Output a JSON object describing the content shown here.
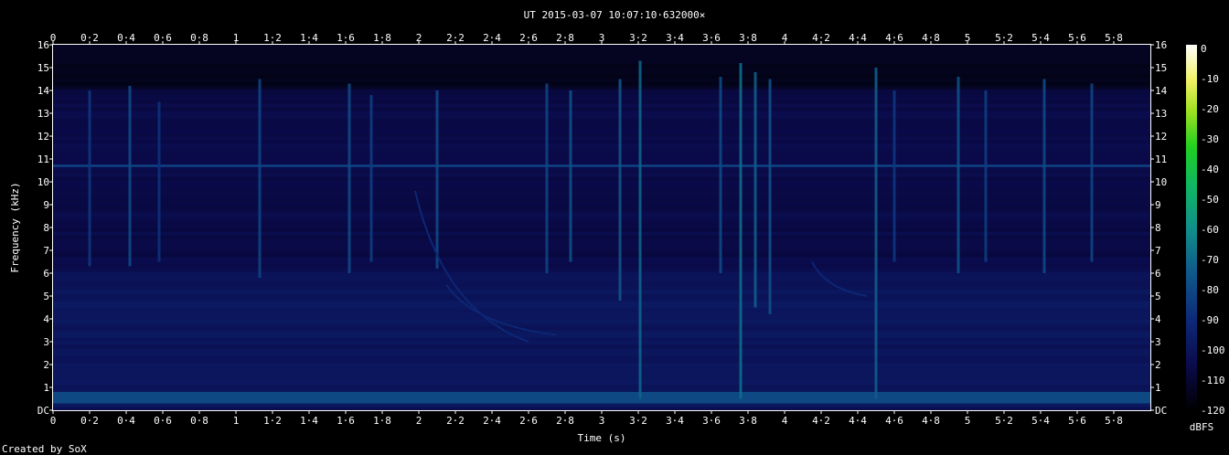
{
  "chart_data": {
    "type": "heatmap",
    "title": "UT 2015-03-07 10:07:10·632000×",
    "xlabel": "Time (s)",
    "ylabel": "Frequency (kHz)",
    "xlim": [
      0,
      5.98
    ],
    "ylim": [
      0,
      16
    ],
    "x_ticks": [
      "0",
      "0·2",
      "0·4",
      "0·6",
      "0·8",
      "1",
      "1·2",
      "1·4",
      "1·6",
      "1·8",
      "2",
      "2·2",
      "2·4",
      "2·6",
      "2·8",
      "3",
      "3·2",
      "3·4",
      "3·6",
      "3·8",
      "4",
      "4·2",
      "4·4",
      "4·6",
      "4·8",
      "5",
      "5·2",
      "5·4",
      "5·6",
      "5·8"
    ],
    "y_ticks": [
      "DC",
      "1",
      "2",
      "3",
      "4",
      "5",
      "6",
      "7",
      "8",
      "9",
      "10",
      "11",
      "12",
      "13",
      "14",
      "15",
      "16"
    ],
    "colorbar": {
      "label": "dBFS",
      "ticks": [
        "0",
        "-10",
        "-20",
        "-30",
        "-40",
        "-50",
        "-60",
        "-70",
        "-80",
        "-90",
        "-100",
        "-110",
        "-120"
      ],
      "range": [
        -120,
        0
      ]
    },
    "features": {
      "constant_tone_khz": 10.7,
      "low_band_khz": [
        0.3,
        0.8
      ],
      "impulses": [
        {
          "t": 0.2,
          "top": 14.0,
          "bottom": 6.3,
          "level": -86
        },
        {
          "t": 0.42,
          "top": 14.2,
          "bottom": 6.3,
          "level": -80
        },
        {
          "t": 0.58,
          "top": 13.5,
          "bottom": 6.5,
          "level": -88
        },
        {
          "t": 1.13,
          "top": 14.5,
          "bottom": 5.8,
          "level": -82
        },
        {
          "t": 1.62,
          "top": 14.3,
          "bottom": 6.0,
          "level": -80
        },
        {
          "t": 1.74,
          "top": 13.8,
          "bottom": 6.5,
          "level": -84
        },
        {
          "t": 2.1,
          "top": 14.0,
          "bottom": 6.2,
          "level": -80
        },
        {
          "t": 2.7,
          "top": 14.3,
          "bottom": 6.0,
          "level": -82
        },
        {
          "t": 2.83,
          "top": 14.0,
          "bottom": 6.5,
          "level": -78
        },
        {
          "t": 3.1,
          "top": 14.5,
          "bottom": 4.8,
          "level": -76
        },
        {
          "t": 3.21,
          "top": 15.3,
          "bottom": 0.5,
          "level": -72
        },
        {
          "t": 3.65,
          "top": 14.6,
          "bottom": 6.0,
          "level": -80
        },
        {
          "t": 3.76,
          "top": 15.2,
          "bottom": 0.5,
          "level": -70
        },
        {
          "t": 3.84,
          "top": 14.8,
          "bottom": 4.5,
          "level": -74
        },
        {
          "t": 3.92,
          "top": 14.5,
          "bottom": 4.2,
          "level": -78
        },
        {
          "t": 4.5,
          "top": 15.0,
          "bottom": 0.5,
          "level": -74
        },
        {
          "t": 4.6,
          "top": 14.0,
          "bottom": 6.5,
          "level": -86
        },
        {
          "t": 4.95,
          "top": 14.6,
          "bottom": 6.0,
          "level": -78
        },
        {
          "t": 5.1,
          "top": 14.0,
          "bottom": 6.5,
          "level": -84
        },
        {
          "t": 5.42,
          "top": 14.5,
          "bottom": 6.0,
          "level": -80
        },
        {
          "t": 5.68,
          "top": 14.3,
          "bottom": 6.5,
          "level": -82
        }
      ],
      "chirps": [
        {
          "t_start": 1.98,
          "f_start": 9.6,
          "t_end": 2.6,
          "f_end": 3.0
        },
        {
          "t_start": 2.15,
          "f_start": 5.5,
          "t_end": 2.75,
          "f_end": 3.3
        },
        {
          "t_start": 4.15,
          "f_start": 6.5,
          "t_end": 4.45,
          "f_end": 5.0
        }
      ]
    }
  },
  "footer": {
    "credit": "Created by SoX"
  },
  "colors": {
    "background": "#000000",
    "axis": "#ffffff"
  }
}
